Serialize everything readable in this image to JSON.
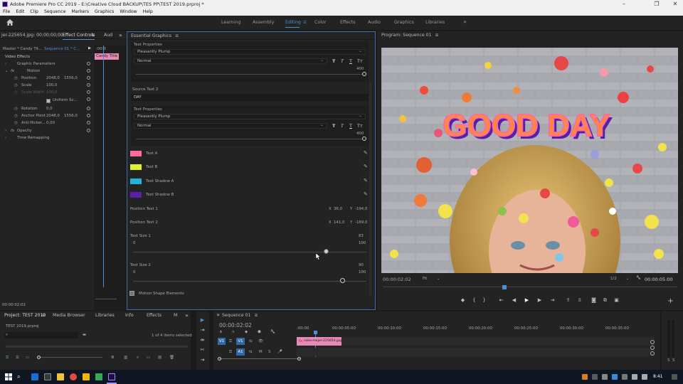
{
  "window": {
    "title": "Adobe Premiere Pro CC 2019 - E:\\Creative Cloud BACKUP\\TES PP\\TEST 2019.prproj *",
    "minimize": "–",
    "maximize": "❐",
    "close": "✕"
  },
  "menu": [
    "File",
    "Edit",
    "Clip",
    "Sequence",
    "Markers",
    "Graphics",
    "Window",
    "Help"
  ],
  "workspaces": [
    "Learning",
    "Assembly",
    "Editing",
    "Color",
    "Effects",
    "Audio",
    "Graphics",
    "Libraries"
  ],
  "workspace_more": "»",
  "effect_controls": {
    "tabs": [
      "jer-225654.jpg: 00;00;00;00",
      "Effect Controls",
      "Aud"
    ],
    "source": "Master * Candy Tit...",
    "sequence": "Sequence 01 * C...",
    "ruler_time": ";00:0",
    "clip_label": "Candy Title",
    "section": "Video Effects",
    "rows": [
      {
        "label": "Graphic Parameters"
      },
      {
        "label": "Motion"
      },
      {
        "label": "Position",
        "v1": "2048,0",
        "v2": "1556,0"
      },
      {
        "label": "Scale",
        "v1": "100,0"
      },
      {
        "label": "Scale Width",
        "v1": "100,0"
      },
      {
        "label": "Uniform Sc..."
      },
      {
        "label": "Rotation",
        "v1": "0,0"
      },
      {
        "label": "Anchor Point",
        "v1": "2048,0",
        "v2": "1556,0"
      },
      {
        "label": "Anti-flicker...",
        "v1": "0,00"
      },
      {
        "label": "Opacity"
      },
      {
        "label": "Time Remapping"
      }
    ],
    "timecode": "00:00:02:02"
  },
  "essential_graphics": {
    "title": "Essential Graphics",
    "text_props_1": {
      "label": "Text Properties",
      "font": "Pleasantly Plump",
      "style": "Normal",
      "size": "400"
    },
    "source_text_label": "Source Text 2",
    "source_text": "DAY",
    "text_props_2": {
      "label": "Text Properties",
      "font": "Pleasantly Plump",
      "style": "Normal",
      "size": "400"
    },
    "style_buttons": [
      "T",
      "T",
      "T",
      "Tт",
      "Tт"
    ],
    "colors": [
      {
        "label": "Text A",
        "color": "#ff6b9e"
      },
      {
        "label": "Text B",
        "color": "#dff22a"
      },
      {
        "label": "Text Shadow A",
        "color": "#22b2da"
      },
      {
        "label": "Text Shadow B",
        "color": "#5a1fa8"
      }
    ],
    "positions": [
      {
        "label": "Position Text 1",
        "x": "36,0",
        "y": "-194,0"
      },
      {
        "label": "Position Text 2",
        "x": "141,0",
        "y": "-169,0"
      }
    ],
    "x_label": "X",
    "y_label": "Y",
    "sizes": [
      {
        "label": "Text Size 1",
        "value": "83",
        "min": "0",
        "max": "100",
        "level": 0.83
      },
      {
        "label": "Text Size 2",
        "value": "90",
        "min": "0",
        "max": "100",
        "level": 0.9
      }
    ],
    "motion_shape": "Motion Shape Elements"
  },
  "program": {
    "title": "Program: Sequence 01",
    "overlay_text": "GOOD DAY",
    "timecode": "00:00:02:02",
    "fit": "Fit",
    "ratio": "1/2",
    "duration": "00:00:05:00"
  },
  "project": {
    "tabs": [
      "Project: TEST 2019",
      "Media Browser",
      "Libraries",
      "Info",
      "Effects",
      "M"
    ],
    "file": "TEST 2019.prproj",
    "search_placeholder": "",
    "items_selected": "1 of 4 items selected"
  },
  "tools": [
    "▶",
    "⇥",
    "✂",
    "⇹",
    "✎",
    "✋",
    "T"
  ],
  "timeline": {
    "title": "Sequence 01",
    "timecode": "00:00:02:02",
    "ruler": [
      ":00:00",
      "00:00:05:00",
      "00:00:10:00",
      "00:00:15:00",
      "00:00:20:00",
      "00:00:25:00",
      "00:00:30:00",
      "00:00:35:00"
    ],
    "tracks": [
      {
        "src": "V1",
        "name": "V1"
      },
      {
        "src": "A1",
        "name": "A1"
      }
    ],
    "clip": "coke-mejer-225654.jpg"
  },
  "taskbar": {
    "time": "8:41"
  }
}
